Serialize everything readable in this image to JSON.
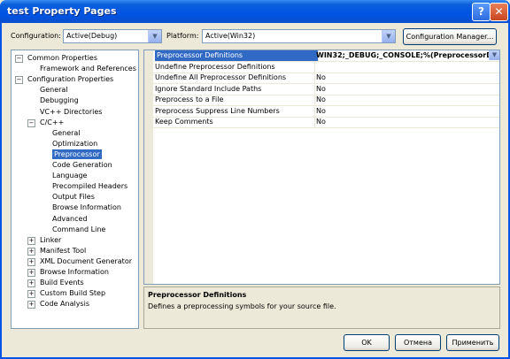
{
  "window": {
    "title": "test Property Pages",
    "help_glyph": "?",
    "close_glyph": "✕"
  },
  "toolbar": {
    "configuration_label": "Configuration:",
    "configuration_value": "Active(Debug)",
    "platform_label": "Platform:",
    "platform_value": "Active(Win32)",
    "config_manager_label": "Configuration Manager..."
  },
  "tree": {
    "items": [
      {
        "label": "Common Properties",
        "expander": "−"
      },
      {
        "label": "Framework and References",
        "expander": ""
      },
      {
        "label": "Configuration Properties",
        "expander": "−"
      },
      {
        "label": "General",
        "expander": ""
      },
      {
        "label": "Debugging",
        "expander": ""
      },
      {
        "label": "VC++ Directories",
        "expander": ""
      },
      {
        "label": "C/C++",
        "expander": "−"
      },
      {
        "label": "General",
        "expander": ""
      },
      {
        "label": "Optimization",
        "expander": ""
      },
      {
        "label": "Preprocessor",
        "expander": ""
      },
      {
        "label": "Code Generation",
        "expander": ""
      },
      {
        "label": "Language",
        "expander": ""
      },
      {
        "label": "Precompiled Headers",
        "expander": ""
      },
      {
        "label": "Output Files",
        "expander": ""
      },
      {
        "label": "Browse Information",
        "expander": ""
      },
      {
        "label": "Advanced",
        "expander": ""
      },
      {
        "label": "Command Line",
        "expander": ""
      },
      {
        "label": "Linker",
        "expander": "+"
      },
      {
        "label": "Manifest Tool",
        "expander": "+"
      },
      {
        "label": "XML Document Generator",
        "expander": "+"
      },
      {
        "label": "Browse Information",
        "expander": "+"
      },
      {
        "label": "Build Events",
        "expander": "+"
      },
      {
        "label": "Custom Build Step",
        "expander": "+"
      },
      {
        "label": "Code Analysis",
        "expander": "+"
      }
    ]
  },
  "properties": {
    "rows": [
      {
        "name": "Preprocessor Definitions",
        "value": "WIN32;_DEBUG;_CONSOLE;%(PreprocessorD"
      },
      {
        "name": "Undefine Preprocessor Definitions",
        "value": ""
      },
      {
        "name": "Undefine All Preprocessor Definitions",
        "value": "No"
      },
      {
        "name": "Ignore Standard Include Paths",
        "value": "No"
      },
      {
        "name": "Preprocess to a File",
        "value": "No"
      },
      {
        "name": "Preprocess Suppress Line Numbers",
        "value": "No"
      },
      {
        "name": "Keep Comments",
        "value": "No"
      }
    ]
  },
  "description": {
    "title": "Preprocessor Definitions",
    "text": "Defines a preprocessing symbols for your source file."
  },
  "buttons": {
    "ok": "OK",
    "cancel": "Отмена",
    "apply": "Применить"
  },
  "colors": {
    "selection": "#316ac5",
    "titlebar": "#0054e3",
    "face": "#ece9d8"
  }
}
